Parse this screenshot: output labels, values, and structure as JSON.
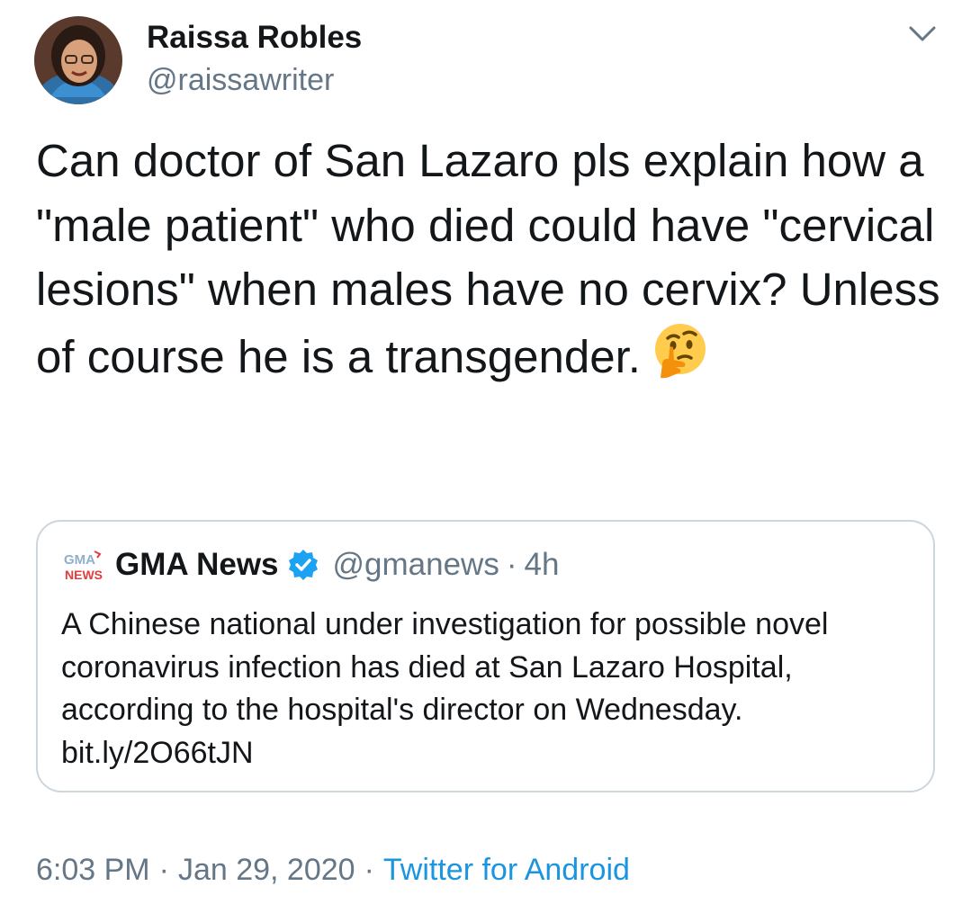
{
  "author": {
    "name": "Raissa Robles",
    "handle": "@raissawriter"
  },
  "tweet": {
    "text": "Can doctor of San Lazaro pls explain how a \"male patient\" who died could have \"cervical lesions\" when males have no cervix? Unless of course he is a transgender.",
    "emoji": "thinking-face-icon"
  },
  "quoted": {
    "logo_text_top": "GMA",
    "logo_text_bottom": "NEWS",
    "name": "GMA News",
    "handle": "@gmanews",
    "separator": "·",
    "time": "4h",
    "text": "A Chinese national under investigation for possible novel coronavirus infection has died at San Lazaro Hospital, according to the hospital's director on Wednesday. bit.ly/2O66tJN"
  },
  "meta": {
    "time": "6:03 PM",
    "separator": "·",
    "date": "Jan 29, 2020",
    "source": "Twitter for Android"
  },
  "colors": {
    "text": "#14171a",
    "secondary": "#657786",
    "link": "#1b95e0",
    "border": "#ccd6dd",
    "verified": "#1da1f2"
  }
}
